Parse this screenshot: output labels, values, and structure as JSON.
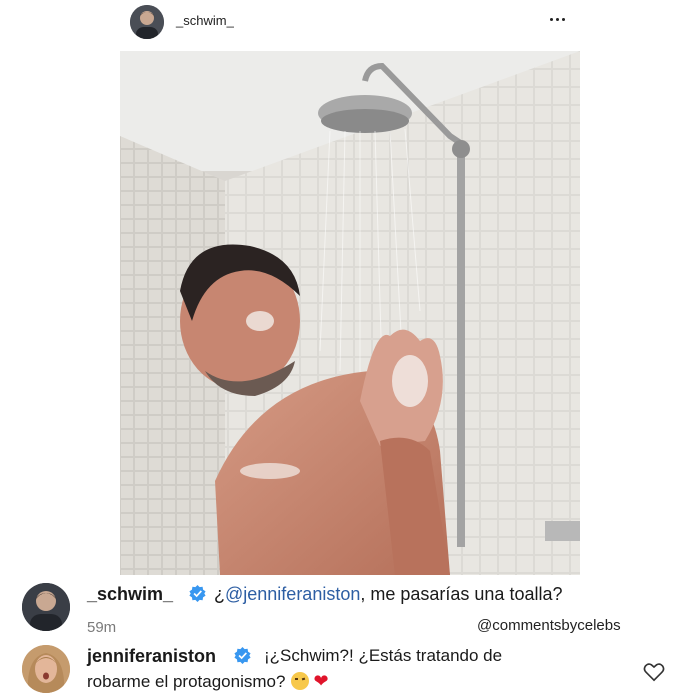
{
  "post": {
    "username": "_schwim_",
    "more_icon": "more-horizontal-icon"
  },
  "photo": {
    "subject": "shower-selfie"
  },
  "comments": [
    {
      "username": "_schwim_",
      "verified": true,
      "mention": "@jenniferaniston",
      "text_before": "¿",
      "text_after": ", me pasarías una toalla?",
      "time": "59m",
      "watermark": "@commentsbycelebs"
    },
    {
      "username": "jenniferaniston",
      "verified": true,
      "text_line1": "¡¿Schwim?! ¿Estás tratando de",
      "text_line2": "robarme el protagonismo?",
      "emoji": [
        "raised-eyebrow-face",
        "red-heart"
      ],
      "like_icon": "heart-outline-icon"
    }
  ],
  "colors": {
    "verified_blue": "#3897f0",
    "mention_blue": "#2d5ea3",
    "heart_red": "#e0142b"
  }
}
